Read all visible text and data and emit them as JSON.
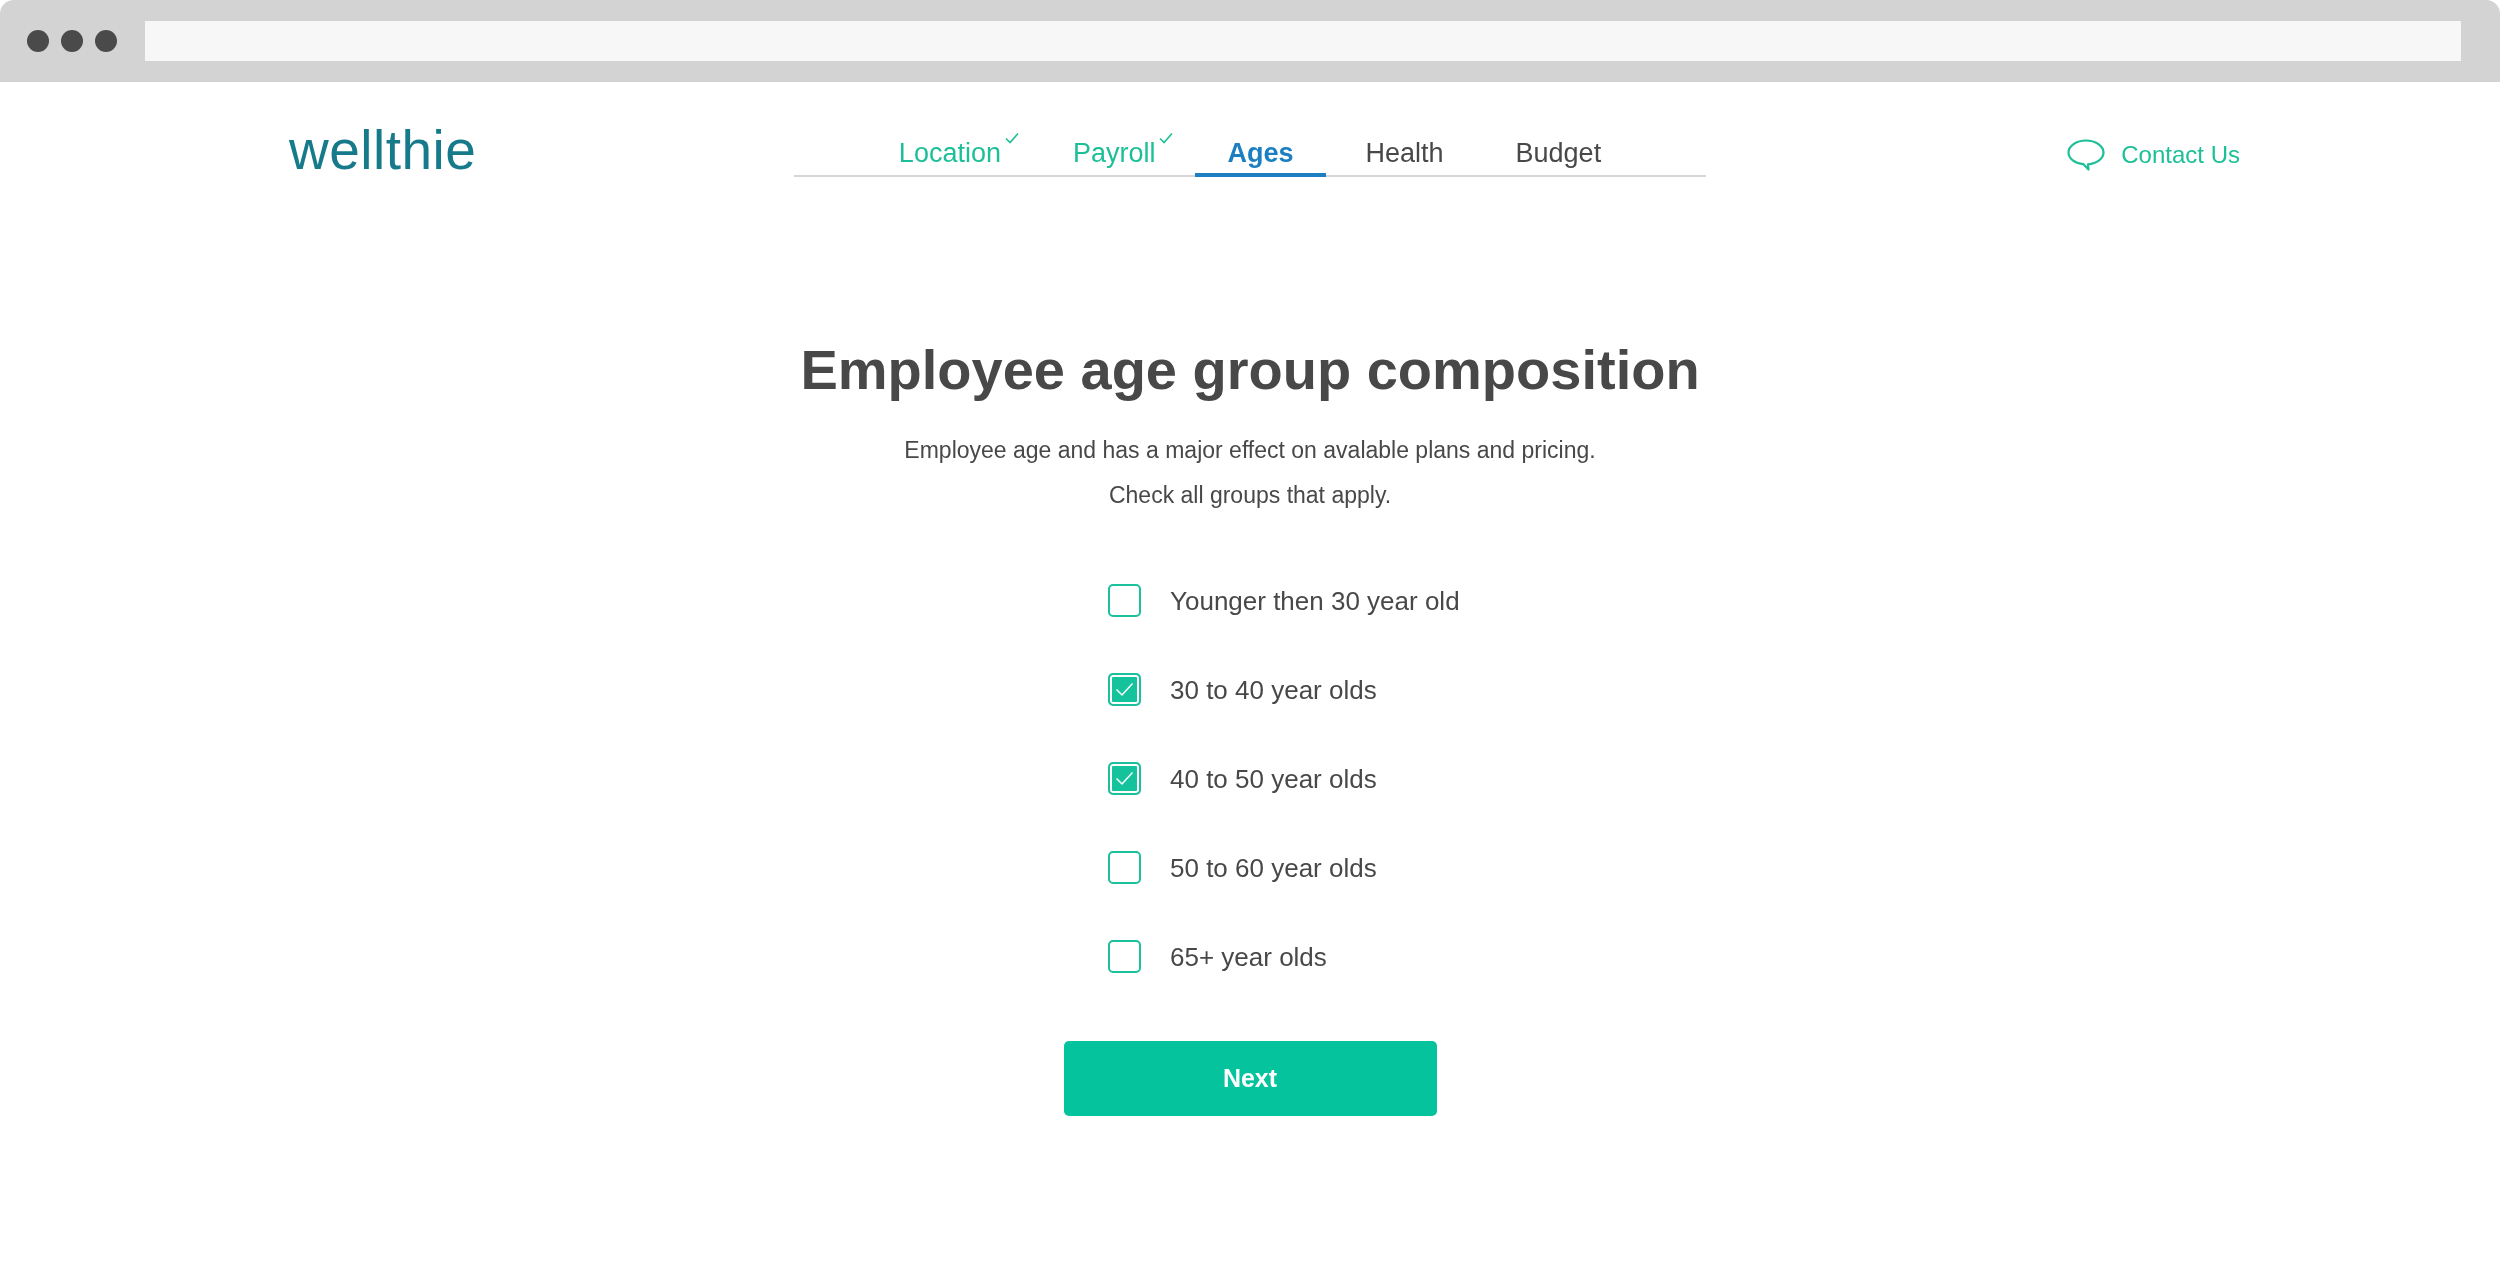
{
  "logo": {
    "text": "wellthie"
  },
  "steps": [
    {
      "label": "Location",
      "selected": false,
      "completed": true
    },
    {
      "label": "Payroll",
      "selected": false,
      "completed": true
    },
    {
      "label": "Ages",
      "selected": true,
      "completed": false
    },
    {
      "label": "Health",
      "selected": false,
      "completed": false
    },
    {
      "label": "Budget",
      "selected": false,
      "completed": false
    }
  ],
  "contact": {
    "label": "Contact Us"
  },
  "heading": "Employee age group composition",
  "description": "Employee age and has a major effect on avalable plans and pricing.",
  "instruction": "Check all groups that apply.",
  "age_groups": [
    {
      "label": "Younger then 30 year old",
      "checked": false
    },
    {
      "label": "30 to 40 year olds",
      "checked": true
    },
    {
      "label": "40 to 50 year olds",
      "checked": true
    },
    {
      "label": "50 to 60 year olds",
      "checked": false
    },
    {
      "label": "65+ year olds",
      "checked": false
    }
  ],
  "next_button": {
    "label": "Next"
  }
}
